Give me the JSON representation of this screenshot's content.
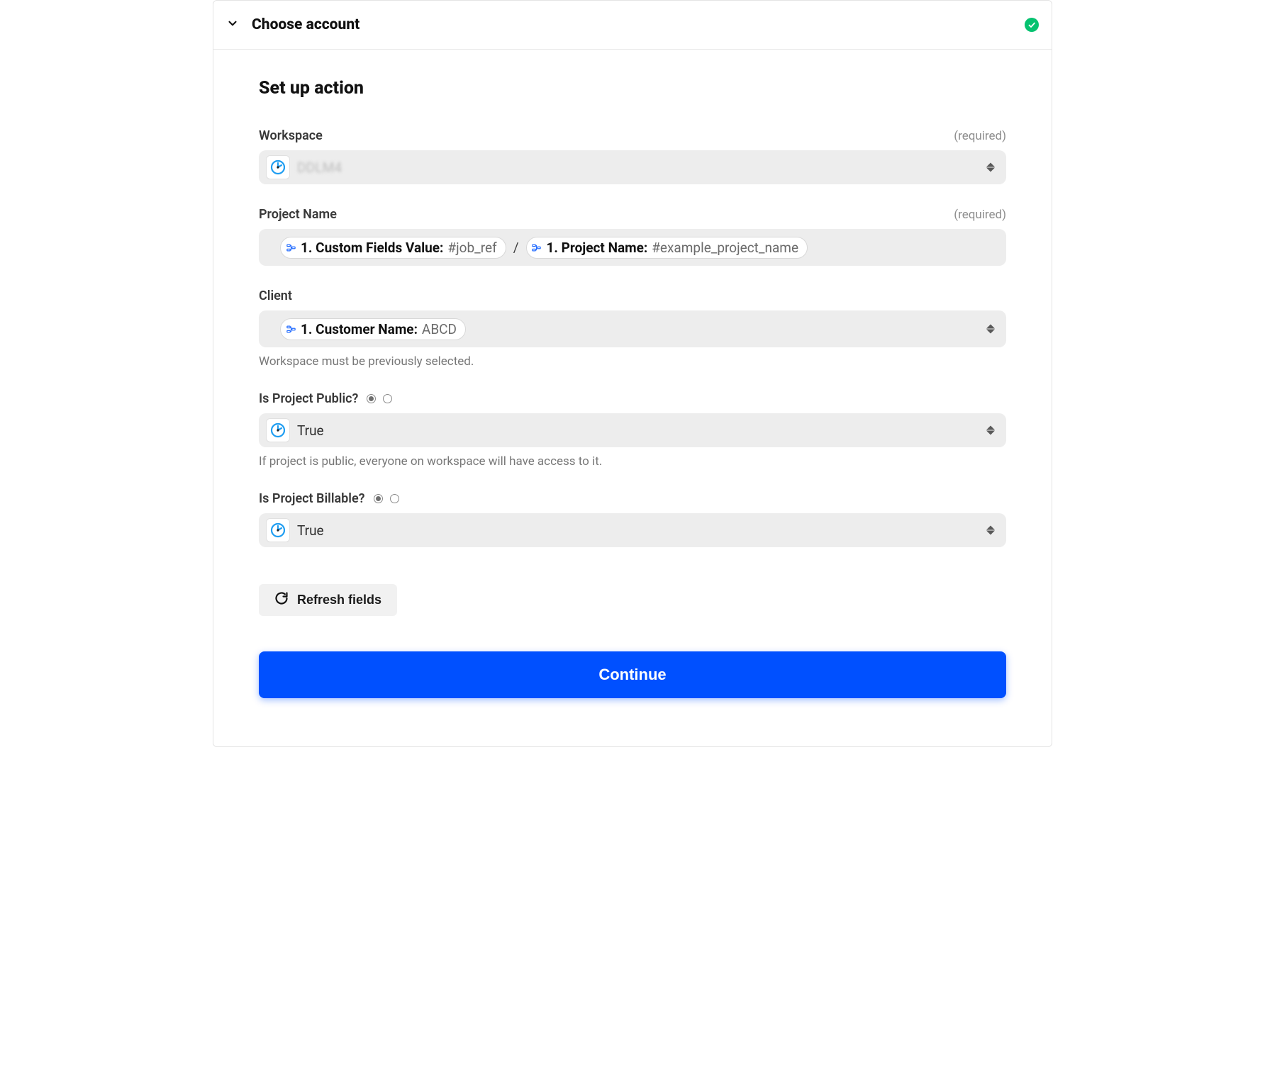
{
  "header": {
    "choose_account": "Choose account"
  },
  "section_title": "Set up action",
  "required_label": "(required)",
  "fields": {
    "workspace": {
      "label": "Workspace",
      "required": true,
      "value": "DDLM4"
    },
    "project_name": {
      "label": "Project Name",
      "required": true,
      "pills": [
        {
          "bold": "1. Custom Fields Value:",
          "grey": "#job_ref"
        },
        {
          "bold": "1. Project Name:",
          "grey": "#example_project_name"
        }
      ],
      "separator": "/"
    },
    "client": {
      "label": "Client",
      "pill": {
        "bold": "1. Customer Name:",
        "grey": "ABCD"
      },
      "helper": "Workspace must be previously selected."
    },
    "is_public": {
      "label": "Is Project Public?",
      "value": "True",
      "helper": "If project is public, everyone on workspace will have access to it."
    },
    "is_billable": {
      "label": "Is Project Billable?",
      "value": "True"
    }
  },
  "buttons": {
    "refresh": "Refresh fields",
    "continue": "Continue"
  },
  "colors": {
    "primary": "#0050ff",
    "success": "#06c270"
  }
}
